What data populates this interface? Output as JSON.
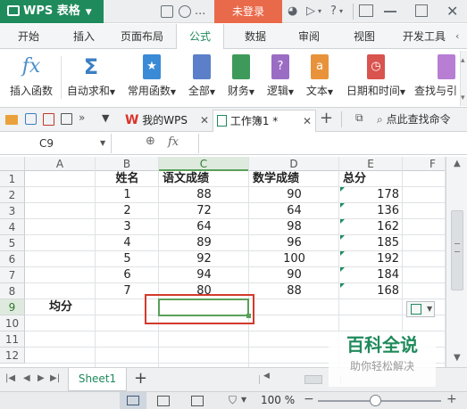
{
  "title_bar": {
    "app_title": "WPS 表格",
    "ellipsis": "...",
    "login_label": "未登录",
    "help_label": "?"
  },
  "ribbon_tabs": [
    "开始",
    "插入",
    "页面布局",
    "公式",
    "数据",
    "审阅",
    "视图",
    "开发工具"
  ],
  "active_tab": "公式",
  "ribbon_buttons": [
    {
      "label": "插入函数",
      "icon": "fx-icon"
    },
    {
      "label": "自动求和",
      "icon": "sigma-icon"
    },
    {
      "label": "常用函数",
      "icon": "star-book-icon"
    },
    {
      "label": "全部",
      "icon": "book-icon"
    },
    {
      "label": "财务",
      "icon": "finance-icon"
    },
    {
      "label": "逻辑",
      "icon": "logic-icon"
    },
    {
      "label": "文本",
      "icon": "text-icon"
    },
    {
      "label": "日期和时间",
      "icon": "clock-icon"
    },
    {
      "label": "查找与引",
      "icon": "lookup-icon"
    }
  ],
  "doc_tabs": {
    "wps_tab": "我的WPS",
    "workbook_tab": "工作簿1 *",
    "search_label": "点此查找命令"
  },
  "formula_bar": {
    "name_box": "C9",
    "fx_label": "fx",
    "formula": ""
  },
  "columns": [
    "A",
    "B",
    "C",
    "D",
    "E",
    "F"
  ],
  "rows": [
    "1",
    "2",
    "3",
    "4",
    "5",
    "6",
    "7",
    "8",
    "9",
    "10",
    "11",
    "12"
  ],
  "sheet": {
    "headers": {
      "B": "姓名",
      "C": "语文成绩",
      "D": "数学成绩",
      "E": "总分"
    },
    "data": [
      {
        "B": "1",
        "C": "88",
        "D": "90",
        "E": "178"
      },
      {
        "B": "2",
        "C": "72",
        "D": "64",
        "E": "136"
      },
      {
        "B": "3",
        "C": "64",
        "D": "98",
        "E": "162"
      },
      {
        "B": "4",
        "C": "89",
        "D": "96",
        "E": "185"
      },
      {
        "B": "5",
        "C": "92",
        "D": "100",
        "E": "192"
      },
      {
        "B": "6",
        "C": "94",
        "D": "90",
        "E": "184"
      },
      {
        "B": "7",
        "C": "80",
        "D": "88",
        "E": "168"
      }
    ],
    "avg_label": "均分"
  },
  "selected_cell": "C9",
  "sheet_tab": "Sheet1",
  "status": {
    "zoom": "100 %",
    "zoom_minus": "−",
    "zoom_plus": "+"
  },
  "watermark": {
    "title": "百科全说",
    "subtitle": "助你轻松解决"
  },
  "colors": {
    "brand_green": "#1f8a5b",
    "login_orange": "#e96a4a",
    "selection_red": "#d33a2c",
    "cell_green": "#5aa05a"
  }
}
